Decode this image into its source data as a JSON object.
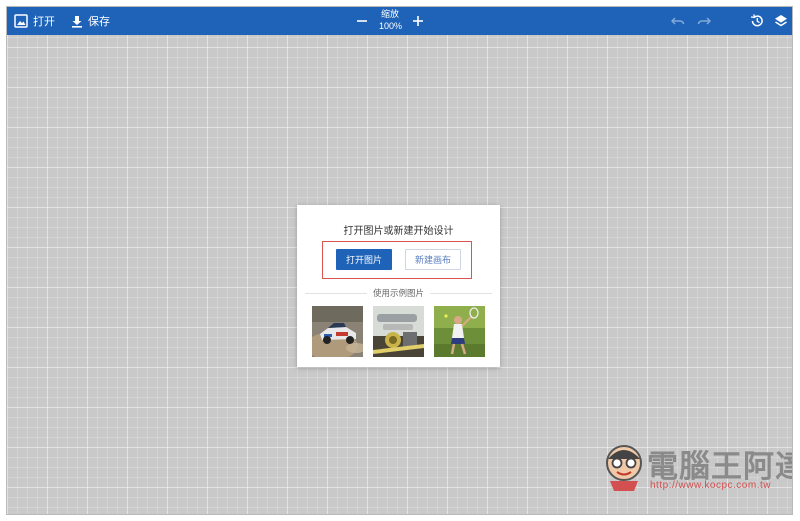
{
  "toolbar": {
    "open_label": "打开",
    "save_label": "保存",
    "zoom_label": "缩放",
    "zoom_value": "100%"
  },
  "dialog": {
    "title": "打开图片或新建开始设计",
    "open_image_label": "打开图片",
    "new_canvas_label": "新建画布",
    "samples_label": "使用示例图片"
  },
  "watermark": {
    "brand": "電腦王阿達",
    "url": "http://www.kocpc.com.tw"
  },
  "colors": {
    "accent": "#1e63b8",
    "highlight": "#d9534f"
  }
}
